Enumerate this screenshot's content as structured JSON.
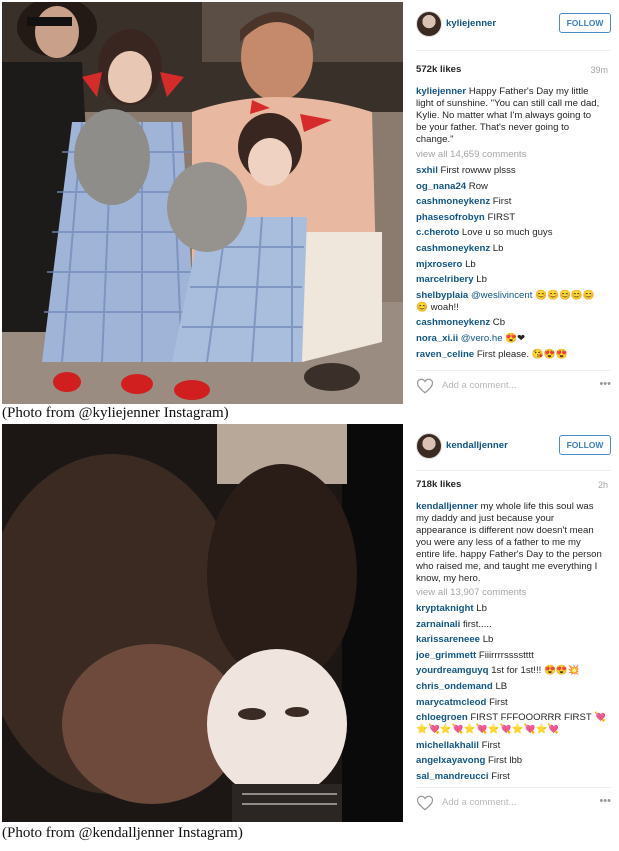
{
  "captions": {
    "first": "(Photo from @kyliejenner Instagram)",
    "second": "(Photo from @kendalljenner Instagram)"
  },
  "post1": {
    "username": "kyliejenner",
    "follow_label": "FOLLOW",
    "likes": "572k likes",
    "time": "39m",
    "caption_user": "kyliejenner",
    "caption_text": "Happy Father's Day my little light of sunshine. \"You can still call me dad, Kylie. No matter what I'm always going to be your father. That's never going to change.\"",
    "view_all": "view all 14,659 comments",
    "comments": [
      {
        "user": "sxhil",
        "text": "First rowww plsss"
      },
      {
        "user": "og_nana24",
        "text": "Row"
      },
      {
        "user": "cashmoneykenz",
        "text": "First"
      },
      {
        "user": "phasesofrobyn",
        "text": "FIRST"
      },
      {
        "user": "c.cheroto",
        "text": "Love u so much guys"
      },
      {
        "user": "cashmoneykenz",
        "text": "Lb"
      },
      {
        "user": "mjxrosero",
        "text": "Lb"
      },
      {
        "user": "marcelribery",
        "text": "Lb"
      },
      {
        "user": "shelbyplaia",
        "text": "😊😊😊😊😊 😊 woah!!",
        "mention": "@weslivincent"
      },
      {
        "user": "cashmoneykenz",
        "text": "Cb"
      },
      {
        "user": "nora_xi.ii",
        "text": "😍❤ ",
        "mention": "@vero.he"
      },
      {
        "user": "raven_celine",
        "text": "First please. 😘😍😍"
      }
    ],
    "add_comment": "Add a comment...",
    "more": "•••"
  },
  "post2": {
    "username": "kendalljenner",
    "follow_label": "FOLLOW",
    "likes": "718k likes",
    "time": "2h",
    "caption_user": "kendalljenner",
    "caption_text": "my whole life this soul was my daddy and just because your appearance is different now doesn't mean you were any less of a father to me my entire life. happy Father's Day to the person who raised me, and taught me everything I know, my hero.",
    "view_all": "view all 13,907 comments",
    "comments": [
      {
        "user": "kryptaknight",
        "text": "Lb"
      },
      {
        "user": "zarnainali",
        "text": "first....."
      },
      {
        "user": "karissareneee",
        "text": "Lb"
      },
      {
        "user": "joe_grimmett",
        "text": "Fiiirrrrsssstttt"
      },
      {
        "user": "yourdreamguyq",
        "text": "1st for 1st!!! 😍😍💥"
      },
      {
        "user": "chris_ondemand",
        "text": "LB"
      },
      {
        "user": "marycatmcleod",
        "text": "First"
      },
      {
        "user": "chloegroen",
        "text": "FIRST FFFOOORRR FIRST 💘⭐💘⭐💘⭐💘⭐💘⭐💘⭐💘"
      },
      {
        "user": "michellakhalil",
        "text": "First"
      },
      {
        "user": "angelxayavong",
        "text": "First lbb"
      },
      {
        "user": "sal_mandreucci",
        "text": "First"
      }
    ],
    "add_comment": "Add a comment...",
    "more": "•••"
  }
}
